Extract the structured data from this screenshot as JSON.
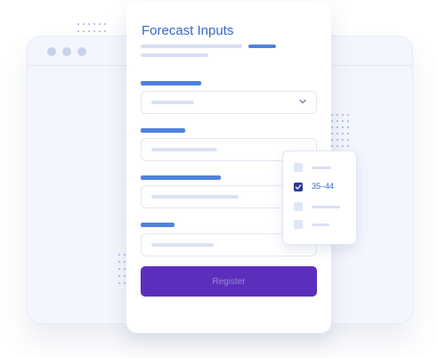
{
  "form": {
    "title": "Forecast Inputs",
    "submit_label": "Register"
  },
  "dropdown": {
    "options": [
      {
        "label": "",
        "checked": false
      },
      {
        "label": "35–44",
        "checked": true
      },
      {
        "label": "",
        "checked": false
      },
      {
        "label": "",
        "checked": false
      }
    ]
  },
  "icons": {
    "select_chevron": "chevron-down-icon",
    "check": "check-icon"
  },
  "colors": {
    "accent": "#4f82dd",
    "title": "#3a68c6",
    "button": "#5b2fbc",
    "checkbox_checked": "#2b3a8f",
    "browser_bg": "#f3f6fd"
  }
}
